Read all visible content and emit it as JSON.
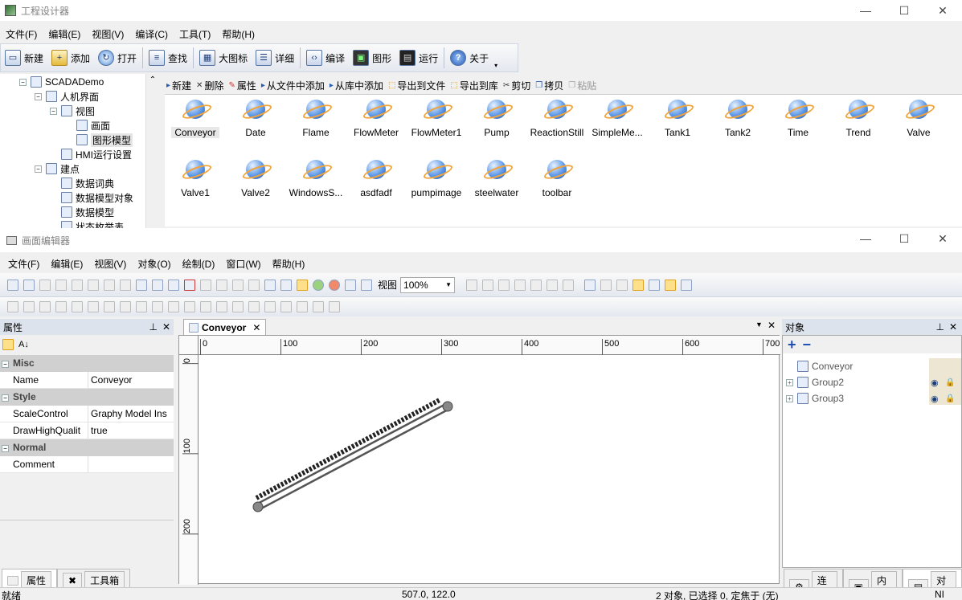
{
  "app": {
    "title": "工程设计器"
  },
  "main_menu": [
    "文件(F)",
    "编辑(E)",
    "视图(V)",
    "编译(C)",
    "工具(T)",
    "帮助(H)"
  ],
  "main_toolbar": [
    {
      "label": "新建",
      "icon": "new-file-icon"
    },
    {
      "label": "添加",
      "icon": "add-folder-icon"
    },
    {
      "label": "打开",
      "icon": "open-icon"
    },
    {
      "label": "查找",
      "icon": "find-icon"
    },
    {
      "label": "大图标",
      "icon": "large-icons-icon"
    },
    {
      "label": "详细",
      "icon": "details-icon"
    },
    {
      "label": "编译",
      "icon": "compile-icon"
    },
    {
      "label": "图形",
      "icon": "graphic-icon"
    },
    {
      "label": "运行",
      "icon": "run-icon"
    },
    {
      "label": "关于",
      "icon": "help-icon"
    }
  ],
  "tree": [
    {
      "label": "SCADADemo",
      "level": 0,
      "expanded": true
    },
    {
      "label": "人机界面",
      "level": 1,
      "expanded": true
    },
    {
      "label": "视图",
      "level": 2,
      "expanded": true
    },
    {
      "label": "画面",
      "level": 3
    },
    {
      "label": "图形模型",
      "level": 3,
      "selected": true
    },
    {
      "label": "HMI运行设置",
      "level": 2
    },
    {
      "label": "建点",
      "level": 1,
      "expanded": true
    },
    {
      "label": "数据词典",
      "level": 2
    },
    {
      "label": "数据模型对象",
      "level": 2
    },
    {
      "label": "数据模型",
      "level": 2
    },
    {
      "label": "状态枚举表",
      "level": 2
    }
  ],
  "library_toolbar": [
    "新建",
    "删除",
    "属性",
    "从文件中添加",
    "从库中添加",
    "导出到文件",
    "导出到库",
    "剪切",
    "拷贝",
    "粘贴"
  ],
  "gallery": [
    "Conveyor",
    "Date",
    "Flame",
    "FlowMeter",
    "FlowMeter1",
    "Pump",
    "ReactionStill",
    "SimpleMe...",
    "Tank1",
    "Tank2",
    "Time",
    "Trend",
    "Valve",
    "Valve1",
    "Valve2",
    "WindowsS...",
    "asdfadf",
    "pumpimage",
    "steelwater",
    "toolbar"
  ],
  "editor": {
    "title": "画面编辑器",
    "menu": [
      "文件(F)",
      "编辑(E)",
      "视图(V)",
      "对象(O)",
      "绘制(D)",
      "窗口(W)",
      "帮助(H)"
    ],
    "view_label": "视图",
    "zoom": "100%"
  },
  "properties": {
    "header": "属性",
    "categories": [
      {
        "name": "Misc",
        "rows": [
          {
            "key": "Name",
            "value": "Conveyor"
          }
        ]
      },
      {
        "name": "Style",
        "rows": [
          {
            "key": "ScaleControl",
            "value": "Graphy Model Ins"
          },
          {
            "key": "DrawHighQualit",
            "value": "true"
          }
        ]
      },
      {
        "name": "Normal",
        "rows": [
          {
            "key": "Comment",
            "value": ""
          }
        ]
      }
    ],
    "bottom_tabs": [
      "属性",
      "工具箱"
    ]
  },
  "doc_tab": {
    "label": "Conveyor"
  },
  "ruler": {
    "h_ticks": [
      "0",
      "100",
      "200",
      "300",
      "400",
      "500",
      "600",
      "700"
    ],
    "v_ticks": [
      "0",
      "100",
      "200"
    ]
  },
  "objects": {
    "header": "对象",
    "items": [
      "Conveyor",
      "Group2",
      "Group3"
    ],
    "bottom_tabs": [
      "连接",
      "内容",
      "对象"
    ]
  },
  "status": {
    "left": "就绪",
    "coords": "507.0, 122.0",
    "selection": "2 对象, 已选择 0, 定焦于 (无)",
    "right": "NI"
  }
}
